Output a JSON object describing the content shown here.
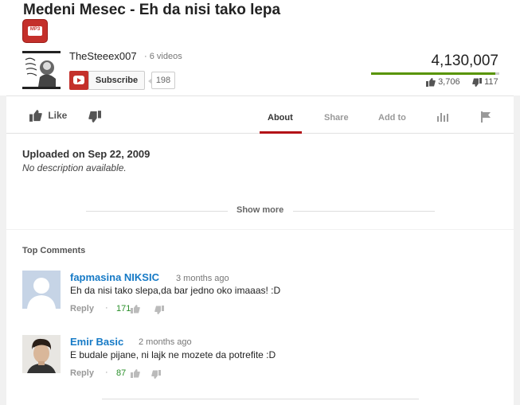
{
  "video": {
    "title": "Medeni Mesec - Eh da nisi tako lepa",
    "badge_text": "MP3"
  },
  "channel": {
    "name": "TheSteeex007",
    "videos": "· 6 videos",
    "subscribe_label": "Subscribe",
    "subscriber_count": "198"
  },
  "stats": {
    "views": "4,130,007",
    "likes": "3,706",
    "dislikes": "117",
    "like_ratio": 0.97
  },
  "actions": {
    "like_label": "Like",
    "tabs": [
      "About",
      "Share",
      "Add to"
    ]
  },
  "about": {
    "uploaded": "Uploaded on Sep 22, 2009",
    "description": "No description available.",
    "show_more": "Show more"
  },
  "comments": {
    "header": "Top Comments",
    "items": [
      {
        "author": "fapmasina NIKSIC",
        "time": "3 months ago",
        "text": "Eh da nisi tako slepa,da bar jedno oko imaaas! :D",
        "reply": "Reply",
        "likes": "171"
      },
      {
        "author": "Emir Basic",
        "time": "2 months ago",
        "text": "E budale pijane, ni lajk ne mozete da potrefite :D",
        "reply": "Reply",
        "likes": "87"
      }
    ]
  },
  "colors": {
    "accent_red": "#c4302b",
    "link_blue": "#167ac6",
    "like_green": "#589400"
  }
}
